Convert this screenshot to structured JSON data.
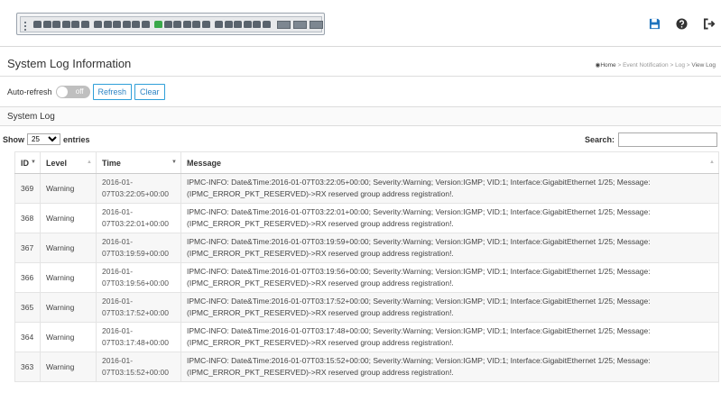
{
  "header": {
    "icons": [
      "save-icon",
      "help-icon",
      "logout-icon"
    ],
    "accent_color": "#2e84c4"
  },
  "page": {
    "title": "System Log Information",
    "breadcrumb": [
      "Home",
      "Event Notification",
      "Log",
      "View Log"
    ]
  },
  "controls": {
    "auto_refresh_label": "Auto-refresh",
    "toggle_state": "off",
    "refresh_label": "Refresh",
    "clear_label": "Clear"
  },
  "section": {
    "title": "System Log"
  },
  "table_tools": {
    "show_label": "Show",
    "show_value": "25",
    "entries_label": "entries",
    "search_label": "Search:",
    "search_value": ""
  },
  "table": {
    "columns": [
      "ID",
      "Level",
      "Time",
      "Message"
    ],
    "rows": [
      {
        "id": "369",
        "level": "Warning",
        "time": [
          "2016-01-",
          "07T03:22:05+00:00"
        ],
        "message": [
          "IPMC-INFO: Date&Time:2016-01-07T03:22:05+00:00; Severity:Warning; Version:IGMP; VID:1; Interface:GigabitEthernet 1/25; Message:",
          "(IPMC_ERROR_PKT_RESERVED)->RX reserved group address registration!."
        ]
      },
      {
        "id": "368",
        "level": "Warning",
        "time": [
          "2016-01-",
          "07T03:22:01+00:00"
        ],
        "message": [
          "IPMC-INFO: Date&Time:2016-01-07T03:22:01+00:00; Severity:Warning; Version:IGMP; VID:1; Interface:GigabitEthernet 1/25; Message:",
          "(IPMC_ERROR_PKT_RESERVED)->RX reserved group address registration!."
        ]
      },
      {
        "id": "367",
        "level": "Warning",
        "time": [
          "2016-01-",
          "07T03:19:59+00:00"
        ],
        "message": [
          "IPMC-INFO: Date&Time:2016-01-07T03:19:59+00:00; Severity:Warning; Version:IGMP; VID:1; Interface:GigabitEthernet 1/25; Message:",
          "(IPMC_ERROR_PKT_RESERVED)->RX reserved group address registration!."
        ]
      },
      {
        "id": "366",
        "level": "Warning",
        "time": [
          "2016-01-",
          "07T03:19:56+00:00"
        ],
        "message": [
          "IPMC-INFO: Date&Time:2016-01-07T03:19:56+00:00; Severity:Warning; Version:IGMP; VID:1; Interface:GigabitEthernet 1/25; Message:",
          "(IPMC_ERROR_PKT_RESERVED)->RX reserved group address registration!."
        ]
      },
      {
        "id": "365",
        "level": "Warning",
        "time": [
          "2016-01-",
          "07T03:17:52+00:00"
        ],
        "message": [
          "IPMC-INFO: Date&Time:2016-01-07T03:17:52+00:00; Severity:Warning; Version:IGMP; VID:1; Interface:GigabitEthernet 1/25; Message:",
          "(IPMC_ERROR_PKT_RESERVED)->RX reserved group address registration!."
        ]
      },
      {
        "id": "364",
        "level": "Warning",
        "time": [
          "2016-01-",
          "07T03:17:48+00:00"
        ],
        "message": [
          "IPMC-INFO: Date&Time:2016-01-07T03:17:48+00:00; Severity:Warning; Version:IGMP; VID:1; Interface:GigabitEthernet 1/25; Message:",
          "(IPMC_ERROR_PKT_RESERVED)->RX reserved group address registration!."
        ]
      },
      {
        "id": "363",
        "level": "Warning",
        "time": [
          "2016-01-",
          "07T03:15:52+00:00"
        ],
        "message": [
          "IPMC-INFO: Date&Time:2016-01-07T03:15:52+00:00; Severity:Warning; Version:IGMP; VID:1; Interface:GigabitEthernet 1/25; Message:",
          "(IPMC_ERROR_PKT_RESERVED)->RX reserved group address registration!."
        ]
      }
    ]
  }
}
